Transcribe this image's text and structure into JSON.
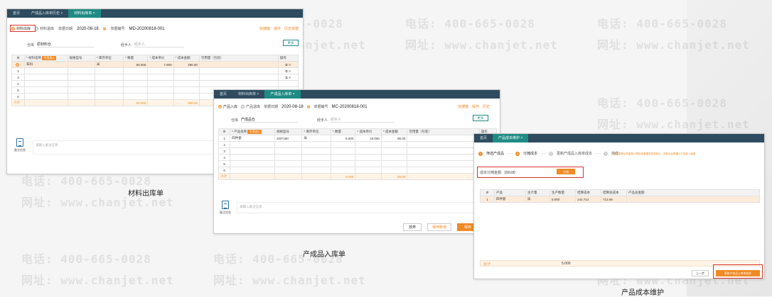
{
  "watermark": {
    "phone": "电话: 400-665-0028",
    "site": "网址: www.chanjet.net"
  },
  "captions": {
    "material_out": "材料出库单",
    "product_in": "产成品入库单",
    "cost_maint": "产品成本维护"
  },
  "win1": {
    "tabs": [
      "首页",
      "产成品入库单历史 ×",
      "材料出库单 ×"
    ],
    "radio1": "材料出库",
    "radio2": "材料退库",
    "date_label": "单据日期",
    "date": "2020-08-18",
    "no_label": "单据编号",
    "no": "MD-20200818-001",
    "links": [
      "快捷键",
      "操作",
      "历史单据"
    ],
    "warehouse_label": "仓库",
    "warehouse": "原材料仓",
    "handler_label": "经手人",
    "handler_ph": "经手人",
    "more": "更多",
    "headers": [
      "⚙",
      "* 材料名称",
      "规格型号",
      "* 库存单位",
      "* 数量",
      "* 成本单价",
      "* 成本金额",
      "可用量（包装）",
      "操作"
    ],
    "ref_tag": "引用选入",
    "rows": [
      [
        "1",
        "布料",
        "",
        "米",
        "50.000",
        "7.800",
        "390.00",
        ""
      ],
      [
        "2",
        "",
        "",
        "",
        "",
        "",
        "",
        ""
      ],
      [
        "3",
        "",
        "",
        "",
        "",
        "",
        "",
        ""
      ],
      [
        "4",
        "",
        "",
        "",
        "",
        "",
        "",
        ""
      ],
      [
        "5",
        "",
        "",
        "",
        "",
        "",
        "",
        ""
      ],
      [
        "6",
        "",
        "",
        "",
        "",
        "",
        "",
        ""
      ]
    ],
    "sum": [
      "小计",
      "",
      "",
      "",
      "50.000",
      "",
      "390.00",
      ""
    ],
    "remark_label": "备注信息",
    "remark_ph": "请输入备注信息"
  },
  "win2": {
    "tabs": [
      "首页",
      "材料出库单 ×",
      "产成品入库单 ×"
    ],
    "radio1": "产品入库",
    "radio2": "产品退库",
    "date_label": "单据日期",
    "date": "2020-08-18",
    "no_label": "单据编号",
    "no": "MC-20200818-001",
    "links": [
      "快捷键",
      "操作",
      "历史"
    ],
    "warehouse_label": "仓库",
    "warehouse": "产成品仓",
    "handler_label": "经手人",
    "handler_ph": "经手人",
    "more": "更多",
    "headers": [
      "⚙",
      "* 产品名称",
      "规格型号",
      "* 库存单位",
      "* 数量",
      "* 成本单价",
      "* 成本金额",
      "可用量（包装）",
      "操作"
    ],
    "ref_tag": "引用选入",
    "rows": [
      [
        "1",
        "四件套",
        "200*180",
        "床",
        "5.000",
        "19.000",
        "95.00",
        ""
      ],
      [
        "2",
        "",
        "",
        "",
        "",
        "",
        "",
        ""
      ],
      [
        "3",
        "",
        "",
        "",
        "",
        "",
        "",
        ""
      ],
      [
        "4",
        "",
        "",
        "",
        "",
        "",
        "",
        ""
      ],
      [
        "5",
        "",
        "",
        "",
        "",
        "",
        "",
        ""
      ],
      [
        "6",
        "",
        "",
        "",
        "",
        "",
        "",
        ""
      ]
    ],
    "sum": [
      "小计",
      "",
      "",
      "",
      "5.000",
      "",
      "95.00",
      ""
    ],
    "remark_label": "备注信息",
    "remark_ph": "请输入备注信息",
    "btn_discard": "放弃",
    "btn_save_new": "保存新增",
    "btn_save": "保存"
  },
  "win3": {
    "tabs": [
      "首页",
      "产品成本维护 ×"
    ],
    "steps": [
      [
        "1",
        "筛选产成品"
      ],
      [
        "2",
        "分摊成本"
      ],
      [
        "3",
        "更新产成品入库单成本"
      ],
      [
        "4",
        "完成"
      ]
    ],
    "hint": "成本更新后将重新计算相关单据的成本单价，请核对后再确认产成品入库单",
    "cost_label": "成本分摊金额:",
    "cost_value": "150.00",
    "alloc_btn": "分摊",
    "headers": [
      "⚙",
      "产品",
      "主计量",
      "生产数量",
      "结算成本",
      "结算总成本",
      "产品总金额"
    ],
    "rows": [
      [
        "1",
        "四件套",
        "床",
        "5.000",
        "142.712",
        "713.56",
        ""
      ]
    ],
    "total_label": "合计",
    "total_qty": "5.000",
    "btn_prev": "上一步",
    "btn_next": "更新产成品入库单成本"
  }
}
